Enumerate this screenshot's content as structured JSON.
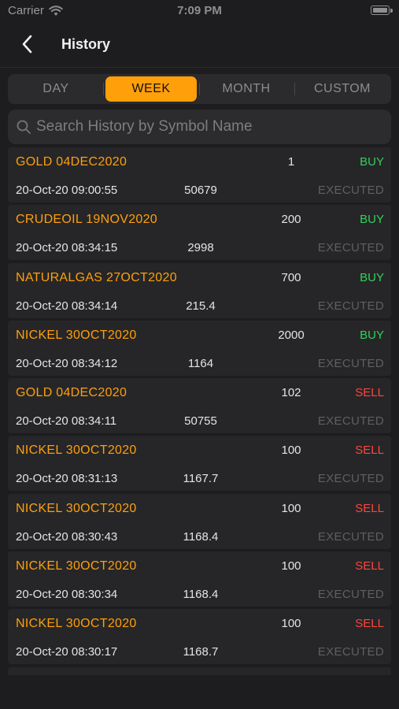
{
  "status_bar": {
    "carrier": "Carrier",
    "time": "7:09 PM"
  },
  "nav": {
    "title": "History"
  },
  "tabs": [
    {
      "label": "DAY",
      "active": false
    },
    {
      "label": "WEEK",
      "active": true
    },
    {
      "label": "MONTH",
      "active": false
    },
    {
      "label": "CUSTOM",
      "active": false
    }
  ],
  "search": {
    "placeholder": "Search History by Symbol Name",
    "value": ""
  },
  "colors": {
    "accent": "#ff9f0a",
    "buy": "#30d158",
    "sell": "#ff453a",
    "executed": "#5f5f63"
  },
  "history": [
    {
      "symbol": "GOLD 04DEC2020",
      "qty": "1",
      "side": "BUY",
      "time": "20-Oct-20 09:00:55",
      "price": "50679",
      "status": "EXECUTED"
    },
    {
      "symbol": "CRUDEOIL 19NOV2020",
      "qty": "200",
      "side": "BUY",
      "time": "20-Oct-20 08:34:15",
      "price": "2998",
      "status": "EXECUTED"
    },
    {
      "symbol": "NATURALGAS 27OCT2020",
      "qty": "700",
      "side": "BUY",
      "time": "20-Oct-20 08:34:14",
      "price": "215.4",
      "status": "EXECUTED"
    },
    {
      "symbol": "NICKEL 30OCT2020",
      "qty": "2000",
      "side": "BUY",
      "time": "20-Oct-20 08:34:12",
      "price": "1164",
      "status": "EXECUTED"
    },
    {
      "symbol": "GOLD 04DEC2020",
      "qty": "102",
      "side": "SELL",
      "time": "20-Oct-20 08:34:11",
      "price": "50755",
      "status": "EXECUTED"
    },
    {
      "symbol": "NICKEL 30OCT2020",
      "qty": "100",
      "side": "SELL",
      "time": "20-Oct-20 08:31:13",
      "price": "1167.7",
      "status": "EXECUTED"
    },
    {
      "symbol": "NICKEL 30OCT2020",
      "qty": "100",
      "side": "SELL",
      "time": "20-Oct-20 08:30:43",
      "price": "1168.4",
      "status": "EXECUTED"
    },
    {
      "symbol": "NICKEL 30OCT2020",
      "qty": "100",
      "side": "SELL",
      "time": "20-Oct-20 08:30:34",
      "price": "1168.4",
      "status": "EXECUTED"
    },
    {
      "symbol": "NICKEL 30OCT2020",
      "qty": "100",
      "side": "SELL",
      "time": "20-Oct-20 08:30:17",
      "price": "1168.7",
      "status": "EXECUTED"
    }
  ]
}
